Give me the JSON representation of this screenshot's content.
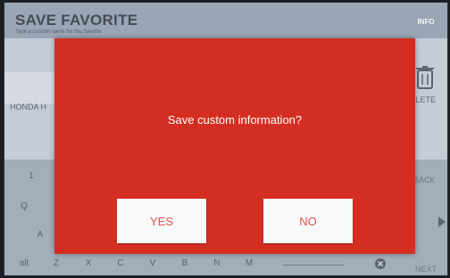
{
  "header": {
    "title": "SAVE FAVORITE",
    "subtitle": "Type a custom name for this favorite",
    "info_label": "INFO"
  },
  "form": {
    "make_value": "HONDA H"
  },
  "actions": {
    "delete_label": "DELETE"
  },
  "keyboard": {
    "row1_visible": [
      "1"
    ],
    "row2_visible": [
      "Q"
    ],
    "row3_visible": [
      "A"
    ],
    "row4": [
      "alt",
      "Z",
      "X",
      "C",
      "V",
      "B",
      "N",
      "M"
    ],
    "back_label": "BACK",
    "next_label": "NEXT",
    "clear_icon": "clear-x-icon"
  },
  "dialog": {
    "message": "Save custom information?",
    "yes_label": "YES",
    "no_label": "NO",
    "color": "#d42e22"
  }
}
